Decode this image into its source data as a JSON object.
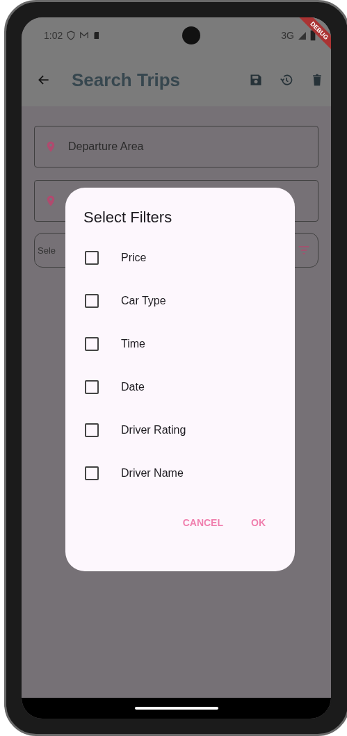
{
  "status_bar": {
    "time": "1:02",
    "network": "3G"
  },
  "debug_banner": {
    "label": "DEBUG"
  },
  "app_bar": {
    "title": "Search Trips"
  },
  "fields": [
    {
      "kind": "location",
      "placeholder": "Departure Area"
    },
    {
      "kind": "location"
    }
  ],
  "filter_chip": {
    "label": "Sele"
  },
  "dialog": {
    "title": "Select Filters",
    "options": [
      {
        "label": "Price",
        "checked": false
      },
      {
        "label": "Car Type",
        "checked": false
      },
      {
        "label": "Time",
        "checked": false
      },
      {
        "label": "Date",
        "checked": false
      },
      {
        "label": "Driver Rating",
        "checked": false
      },
      {
        "label": "Driver Name",
        "checked": false
      }
    ],
    "buttons": [
      "CANCEL",
      "OK"
    ]
  }
}
